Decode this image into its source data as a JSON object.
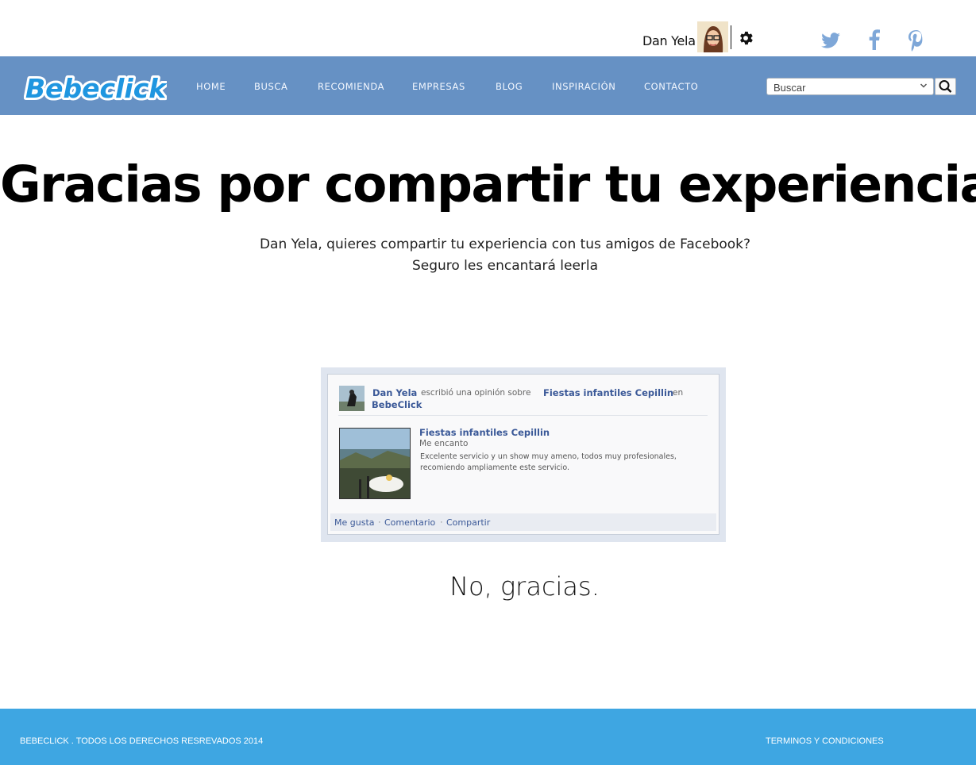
{
  "user": {
    "name": "Dan Yela"
  },
  "social": {
    "twitter_icon": "twitter-icon",
    "facebook_icon": "facebook-icon",
    "pinterest_icon": "pinterest-icon",
    "icon_color": "#7ea7d8"
  },
  "nav": {
    "logo_text": "Bebeclick",
    "items": [
      "HOME",
      "BUSCA",
      "RECOMIENDA",
      "EMPRESAS",
      "BLOG",
      "INSPIRACIÓN",
      "CONTACTO"
    ],
    "search_value": "Buscar",
    "bg_color": "#6691c4"
  },
  "main": {
    "title": "Gracias por compartir tu experiencia",
    "subtitle_line1": "Dan Yela, quieres compartir tu experiencia con tus amigos de Facebook?",
    "subtitle_line2": "Seguro les encantará leerla",
    "no_thanks": "No, gracias."
  },
  "fb_card": {
    "author": "Dan Yela",
    "action": "escribió una opinión sobre",
    "target": "Fiestas infantiles Cepillin",
    "in_text": "en",
    "site": "BebeClick",
    "post_title": "Fiestas infantiles Cepillin",
    "rating_text": "Me encanto",
    "review": "Excelente servicio y un show muy ameno, todos muy profesionales, recomiendo ampliamente este servicio.",
    "actions": [
      "Me gusta",
      "Comentario",
      "Compartir"
    ],
    "link_color": "#3b5998"
  },
  "footer": {
    "copyright": "BEBECLICK . TODOS LOS DERECHOS RESREVADOS 2014",
    "terms": "TERMINOS Y CONDICIONES",
    "bg_color": "#3ea6e2"
  }
}
